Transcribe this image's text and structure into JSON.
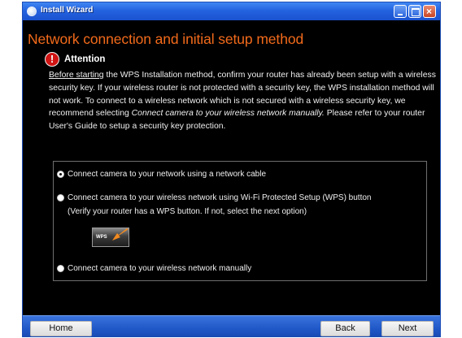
{
  "window": {
    "title": "Install Wizard",
    "close_glyph": "×"
  },
  "heading": "Network connection and initial setup method",
  "attention": {
    "icon_glyph": "!",
    "label": "Attention",
    "body_underlined": "Before starting",
    "body_part1": " the WPS Installation method, confirm your router has already been setup with a wireless security key. If your wireless router is not protected with a security key, the WPS installation method will not work. To connect to a wireless network which is not secured with a wireless security key, we recommend selecting ",
    "body_italic": "Connect camera to your wireless network manually.",
    "body_part2": " Please refer to your router User's Guide to setup a security key protection."
  },
  "options": [
    {
      "label": "Connect camera to your network using a network cable",
      "selected": true
    },
    {
      "label": "Connect camera to your wireless network using Wi-Fi Protected Setup (WPS) button",
      "note": "(Verify your router has a WPS button. If not, select the next option)",
      "selected": false
    },
    {
      "label": "Connect camera to your wireless network manually",
      "selected": false
    }
  ],
  "wps_image_label": "WPS",
  "buttons": {
    "home": "Home",
    "back": "Back",
    "next": "Next"
  },
  "colors": {
    "heading": "#f26a1b",
    "titlebar": "#2463e0",
    "background": "#000000",
    "alert_icon": "#d11414"
  }
}
